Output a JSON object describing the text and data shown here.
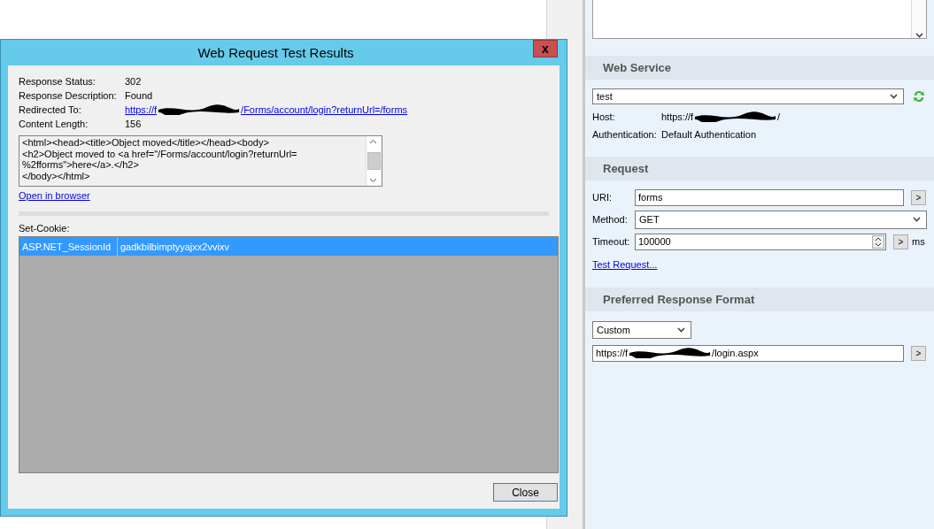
{
  "dialog": {
    "title": "Web Request Test Results",
    "close_glyph": "x",
    "fields": [
      {
        "label": "Response Status:",
        "kind": "text",
        "parts": [
          "302"
        ]
      },
      {
        "label": "Response Description:",
        "kind": "text",
        "parts": [
          "Found"
        ]
      },
      {
        "label": "Redirected To:",
        "kind": "link",
        "parts": [
          "https://f",
          "/Forms/account/login?returnUrl=/forms"
        ]
      },
      {
        "label": "Content Length:",
        "kind": "text",
        "parts": [
          "156"
        ]
      }
    ],
    "response_body": [
      "<html><head><title>Object moved</title></head><body>",
      "<h2>Object moved to <a href=\"/Forms/account/login?returnUrl=",
      "%2fforms\">here</a>.</h2>",
      "</body></html>"
    ],
    "open_link": "Open in browser",
    "set_cookie_label": "Set-Cookie:",
    "cookies": [
      {
        "name": "ASP.NET_SessionId",
        "value": "gadkbilbimptyyajxx2vvixv",
        "selected": true
      }
    ],
    "close_button": "Close"
  },
  "panel": {
    "web_service": {
      "header": "Web Service",
      "service": "test",
      "host_label": "Host:",
      "host": [
        "https://f",
        "/"
      ],
      "auth_label": "Authentication:",
      "auth": "Default Authentication"
    },
    "request": {
      "header": "Request",
      "uri_label": "URI:",
      "uri": "forms",
      "go": ">",
      "method_label": "Method:",
      "method": "GET",
      "timeout_label": "Timeout:",
      "timeout": "100000",
      "timeout_go": ">",
      "unit": "ms",
      "test_link": "Test Request..."
    },
    "format": {
      "header": "Preferred Response Format",
      "format": "Custom",
      "url": [
        "https://f",
        "/login.aspx"
      ],
      "go": ">"
    }
  }
}
